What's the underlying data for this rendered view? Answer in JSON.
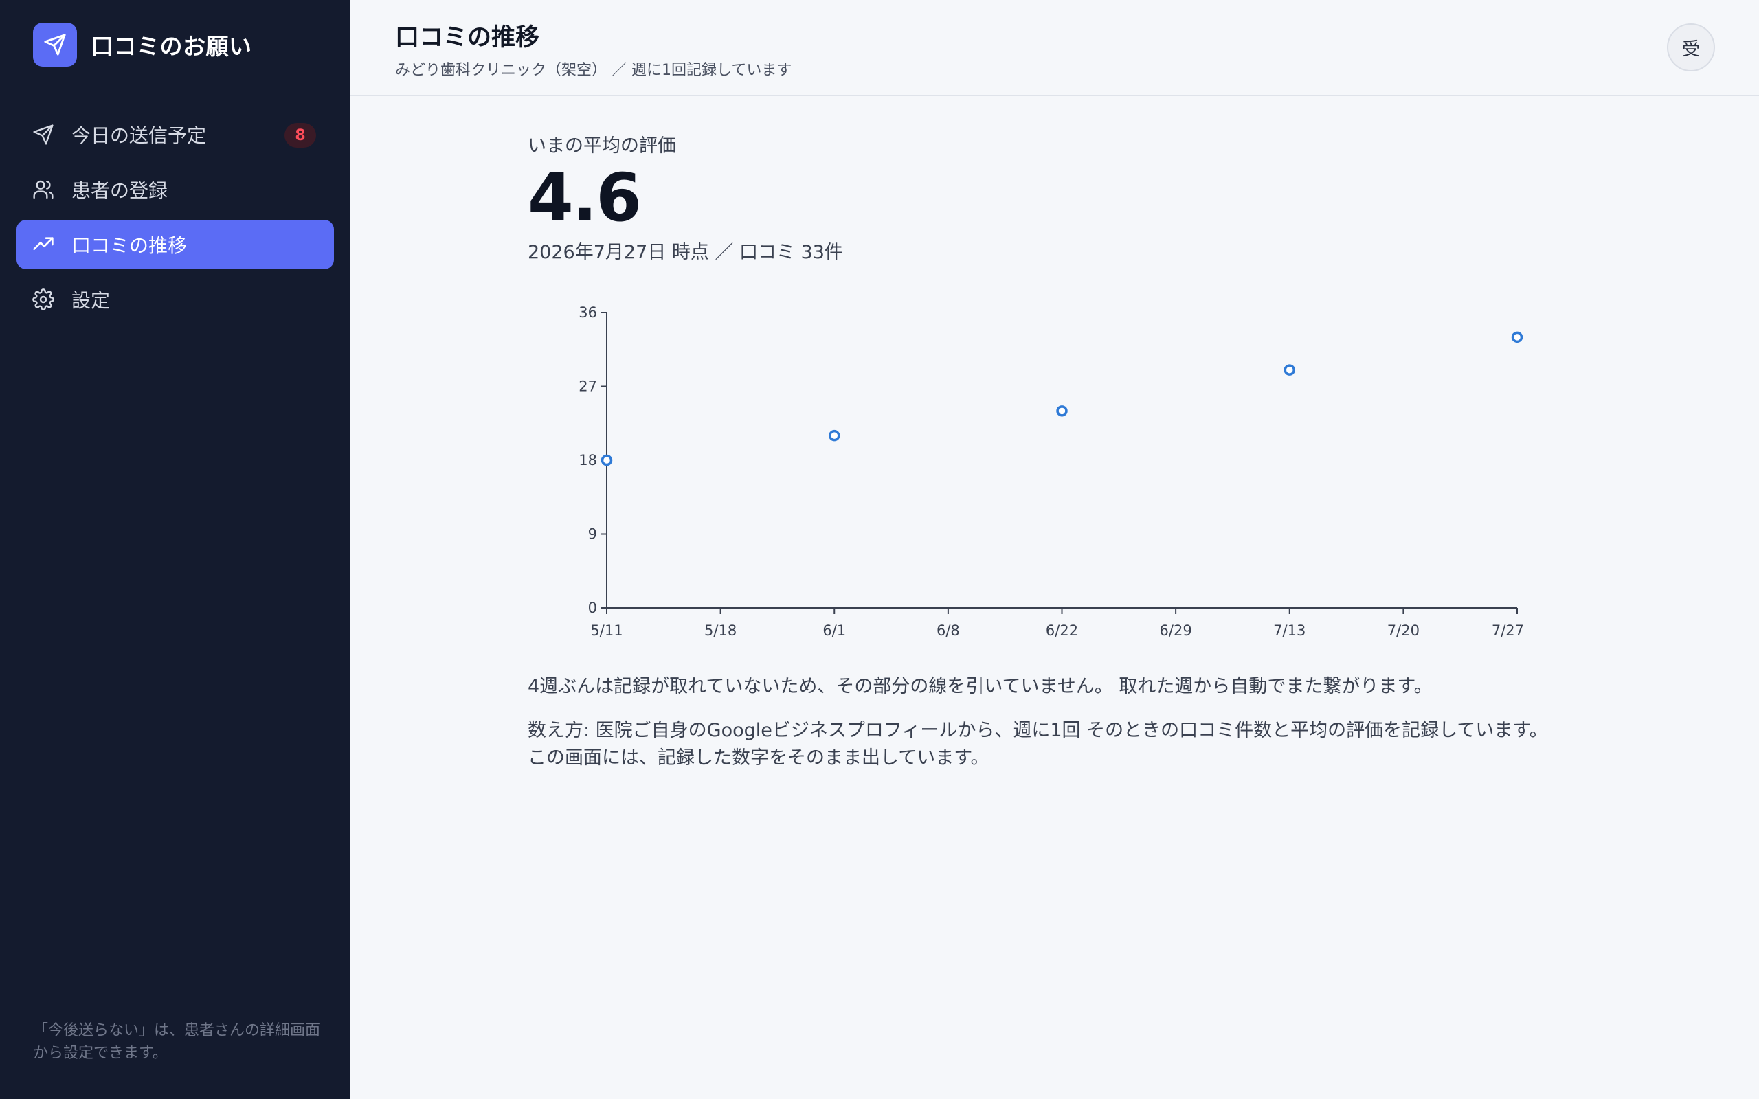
{
  "sidebar": {
    "brand_title": "口コミのお願い",
    "items": [
      {
        "label": "今日の送信予定",
        "badge": "8",
        "active": false,
        "icon": "send-icon"
      },
      {
        "label": "患者の登録",
        "badge": "",
        "active": false,
        "icon": "users-icon"
      },
      {
        "label": "口コミの推移",
        "badge": "",
        "active": true,
        "icon": "trending-up-icon"
      },
      {
        "label": "設定",
        "badge": "",
        "active": false,
        "icon": "gear-icon"
      }
    ],
    "note": "「今後送らない」は、患者さんの詳細画面から設定できます。"
  },
  "header": {
    "title": "口コミの推移",
    "subtitle": "みどり歯科クリニック（架空） ／ 週に1回記録しています",
    "avatar_text": "受"
  },
  "summary": {
    "label": "いまの平均の評価",
    "value": "4.6",
    "meta": "2026年7月27日 時点 ／ 口コミ 33件"
  },
  "chart_data": {
    "type": "scatter",
    "x_ticks": [
      "5/11",
      "5/18",
      "6/1",
      "6/8",
      "6/22",
      "6/29",
      "7/13",
      "7/20",
      "7/27"
    ],
    "y_ticks": [
      0,
      9,
      18,
      27,
      36
    ],
    "ylim": [
      0,
      36
    ],
    "points": [
      {
        "x": "5/11",
        "y": 18
      },
      {
        "x": "6/1",
        "y": 21
      },
      {
        "x": "6/22",
        "y": 24
      },
      {
        "x": "7/13",
        "y": 29
      },
      {
        "x": "7/27",
        "y": 33
      }
    ],
    "point_color": "#2f7ad6"
  },
  "notes": {
    "gap": "4週ぶんは記録が取れていないため、その部分の線を引いていません。 取れた週から自動でまた繋がります。",
    "method_line1": "数え方: 医院ご自身のGoogleビジネスプロフィールから、週に1回 そのときの口コミ件数と平均の評価を記録しています。",
    "method_line2": "この画面には、記録した数字をそのまま出しています。"
  },
  "colors": {
    "sidebar_bg": "#141b2e",
    "accent": "#5b6cf5",
    "badge_text": "#ff4d5a"
  }
}
